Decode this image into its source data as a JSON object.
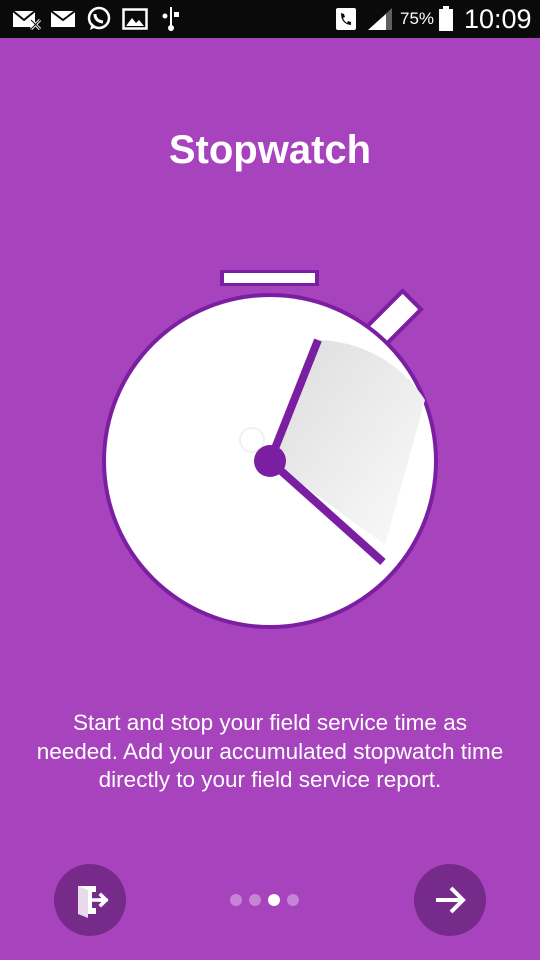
{
  "status_bar": {
    "battery_percent": "75%",
    "time": "10:09",
    "icons": [
      "missed-call-icon",
      "mail-icon",
      "whatsapp-icon",
      "gallery-icon",
      "usb-icon",
      "phone-call-icon",
      "signal-icon",
      "battery-icon"
    ]
  },
  "onboarding": {
    "title": "Stopwatch",
    "description": "Start and stop your field service time as needed. Add your accumulated stopwatch time directly to your field service report.",
    "page_count": 4,
    "current_page": 3
  },
  "colors": {
    "background": "#a743bd",
    "accent_dark": "#7b1fa2",
    "button_bg": "#762b8a",
    "dial": "#ffffff"
  }
}
